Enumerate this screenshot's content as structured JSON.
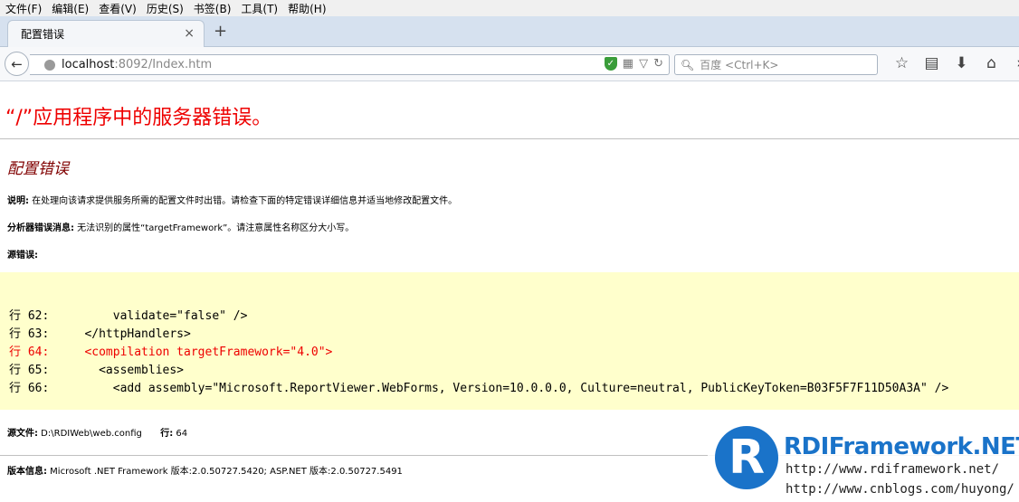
{
  "menu": [
    "文件(F)",
    "编辑(E)",
    "查看(V)",
    "历史(S)",
    "书签(B)",
    "工具(T)",
    "帮助(H)"
  ],
  "tab": {
    "title": "配置错误",
    "close": "×",
    "new": "+"
  },
  "nav": {
    "back": "←",
    "url_host": "localhost",
    "url_rest": ":8092/Index.htm",
    "search_placeholder": "百度 <Ctrl+K>"
  },
  "page": {
    "title": "“/”应用程序中的服务器错误。",
    "subtitle": "配置错误",
    "desc_label": "说明:",
    "desc_text": " 在处理向该请求提供服务所需的配置文件时出错。请检查下面的特定错误详细信息并适当地修改配置文件。",
    "parser_label": "分析器错误消息:",
    "parser_text": " 无法识别的属性“targetFramework”。请注意属性名称区分大小写。",
    "source_label": "源错误:",
    "code_lines": [
      "行 62:         validate=\"false\" />",
      "行 63:     </httpHandlers>",
      "行 64:     <compilation targetFramework=\"4.0\">",
      "行 65:       <assemblies>",
      "行 66:         <add assembly=\"Microsoft.ReportViewer.WebForms, Version=10.0.0.0, Culture=neutral, PublicKeyToken=B03F5F7F11D50A3A\" />"
    ],
    "file_label": "源文件:",
    "file_value": " D:\\RDIWeb\\web.config",
    "line_label": "行:",
    "line_value": " 64",
    "version_label": "版本信息:",
    "version_text": " Microsoft .NET Framework 版本:2.0.50727.5420; ASP.NET 版本:2.0.50727.5491"
  },
  "watermark": {
    "logo_letter": "R",
    "title": "RDIFramework.NET",
    "url1": "http://www.rdiframework.net/",
    "url2": "http://www.cnblogs.com/huyong/"
  },
  "colors": {
    "error_title": "#ee0000",
    "subtitle": "#800000",
    "code_bg": "#ffffcc",
    "brand": "#1a73c9"
  }
}
